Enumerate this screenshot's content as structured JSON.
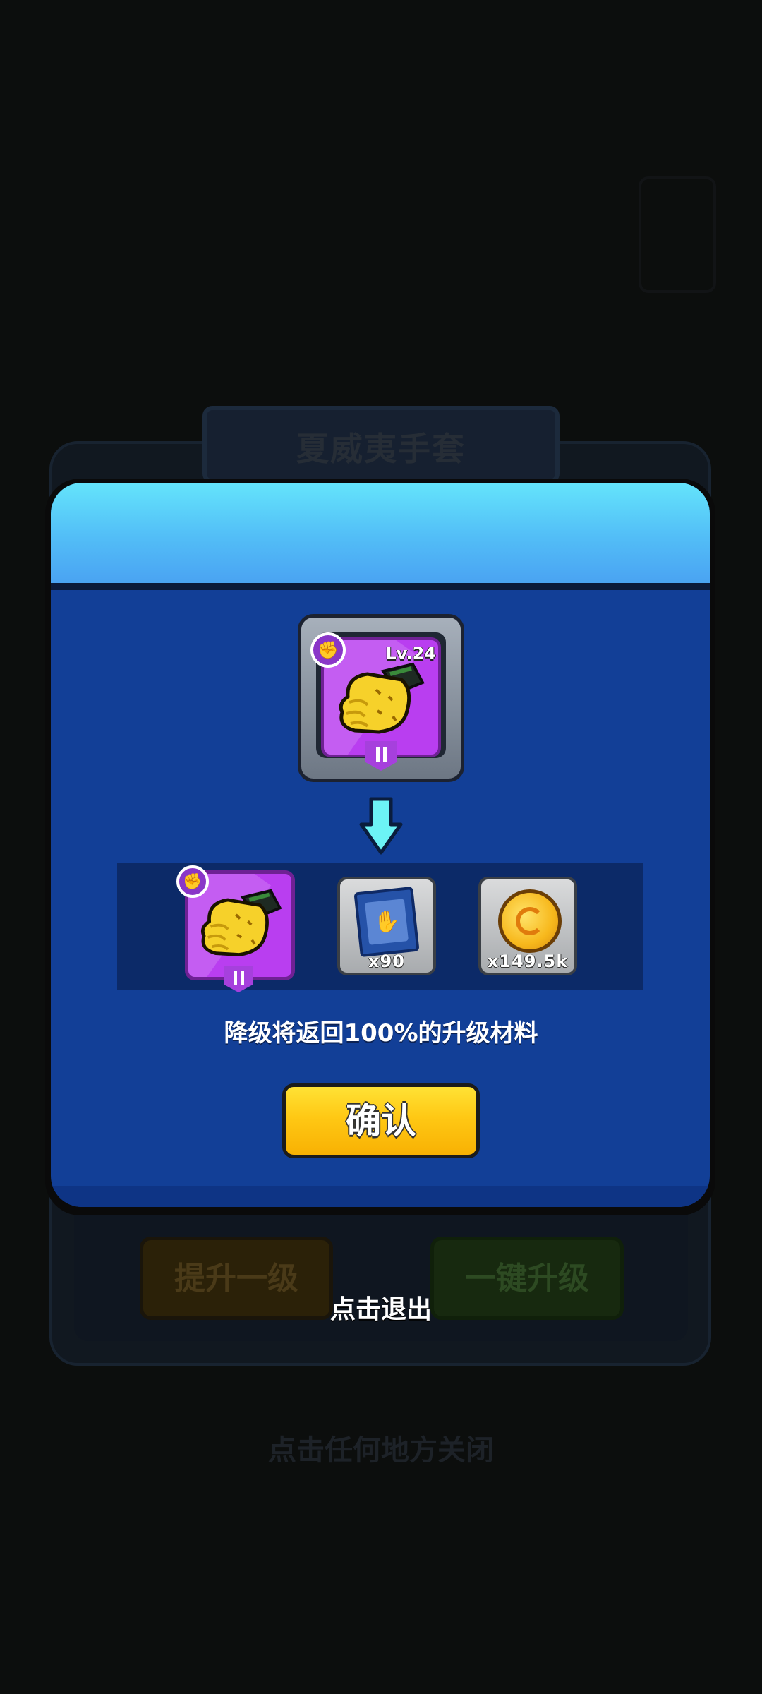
{
  "background": {
    "panel_title": "夏威夷手套",
    "upgrade_one_label": "提升一级",
    "upgrade_all_label": "一键升级",
    "close_hint": "点击任何地方关闭"
  },
  "dialog": {
    "item": {
      "icon": "glove-icon",
      "level_label": "Lv.24",
      "type_icon": "fist-type-icon",
      "rank": "II",
      "rarity_color": "#b93ef0"
    },
    "arrow_icon": "down-arrow-icon",
    "returns": [
      {
        "icon": "glove-icon",
        "rank": "II",
        "quantity": ""
      },
      {
        "icon": "glove-blueprint-icon",
        "quantity": "x90"
      },
      {
        "icon": "gold-coin-icon",
        "quantity": "x149.5k"
      }
    ],
    "description": "降级将返回100%的升级材料",
    "confirm_label": "确认"
  },
  "exit_hint": "点击退出",
  "colors": {
    "dialog_body": "#123f97",
    "header_top": "#64e4fb",
    "confirm_button": "#ffc814"
  }
}
